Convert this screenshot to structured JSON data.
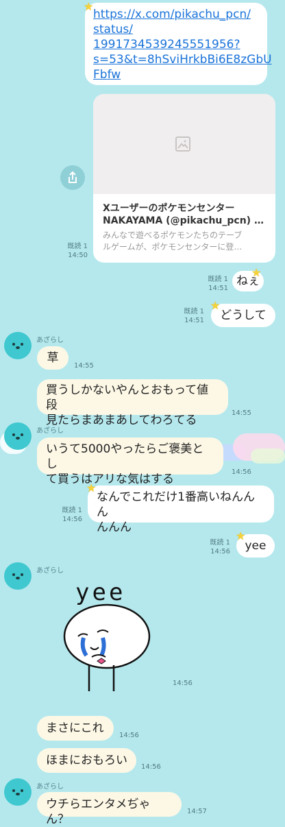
{
  "messages": {
    "link_url_lines": [
      "https://x.com/pikachu_pcn/",
      "status/",
      "1991734539245551956?",
      "s=53&t=8hSviHrkbBi6E8zGbU",
      "Fbfw"
    ],
    "card_title_line1": "Xユーザーのポケモンセンター",
    "card_title_line2": "NAKAYAMA (@pikachu_pcn) …",
    "card_desc_line1": "みんなで遊べるポケモンたちのテーブ",
    "card_desc_line2": "ルゲームが、ポケモンセンターに登…",
    "card_read": "既読 1",
    "card_time": "14:50",
    "m_nee": "ねぇ",
    "m_nee_read": "既読 1",
    "m_nee_time": "14:51",
    "m_doushite": "どうして",
    "m_doushite_read": "既読 1",
    "m_doushite_time": "14:51",
    "sender1": "あざらし",
    "m_kusa": "草",
    "m_kusa_time": "14:55",
    "m_kau_line1": "買うしかないやんとおもって値段",
    "m_kau_line2": "見たらまあまあしてわろてる",
    "m_kau_time": "14:55",
    "sender2": "あざらし",
    "m_iute_line1": "いうて5000やったらご褒美とし",
    "m_iute_line2": "て買うはアリな気はする",
    "m_iute_time": "14:56",
    "m_nande_line1": "なんでこれだけ1番高いねんんん",
    "m_nande_line2": "んんん",
    "m_nande_read": "既読 1",
    "m_nande_time": "14:56",
    "m_yee": "yee",
    "m_yee_read": "既読 1",
    "m_yee_time": "14:56",
    "sender3": "あざらし",
    "sticker_text": "yee",
    "sticker_time": "14:56",
    "m_masani": "まさにこれ",
    "m_masani_time": "14:56",
    "m_homani": "ほまにおもろい",
    "m_homani_time": "14:56",
    "sender4": "あざらし",
    "m_uchira": "ウチらエンタメぢゃん？",
    "m_uchira_time": "14:57"
  },
  "colors": {
    "background": "#b5e8ed",
    "outgoing_bubble": "#ffffff",
    "incoming_bubble": "#fdf8e6",
    "link": "#1a73d9",
    "avatar": "#3fc8cf"
  },
  "icons": [
    "star-icon",
    "share-icon",
    "image-placeholder-icon",
    "seal-avatar-icon"
  ]
}
